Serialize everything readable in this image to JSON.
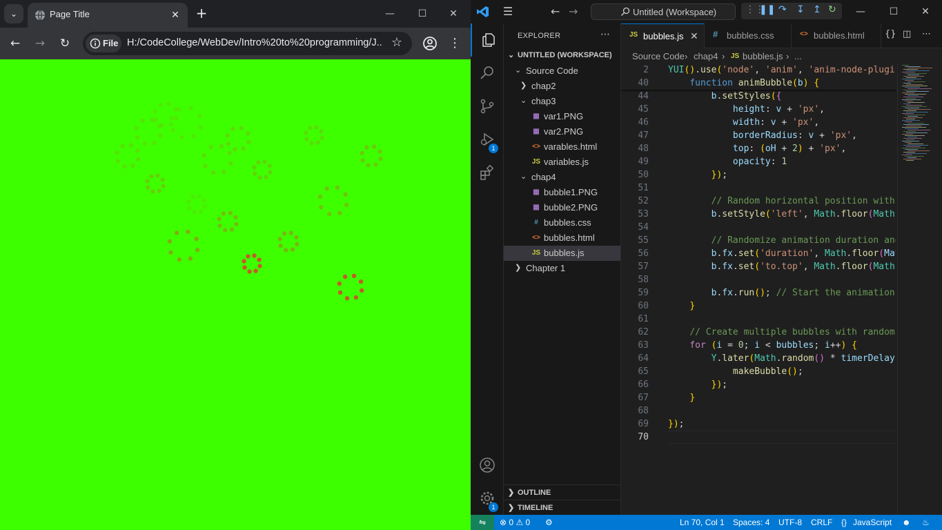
{
  "browser": {
    "tab_title": "Page Title",
    "address_chip": "File",
    "url": "H:/CodeCollege/WebDev/Intro%20to%20programming/J...",
    "page_background": "#3eff00"
  },
  "vscode": {
    "search_text": "Untitled (Workspace)",
    "explorer": {
      "header": "EXPLORER",
      "workspace": "UNTITLED (WORKSPACE)",
      "items": [
        {
          "label": "Source Code",
          "kind": "folder-open"
        },
        {
          "label": "chap2",
          "kind": "folder-closed"
        },
        {
          "label": "chap3",
          "kind": "folder-open"
        },
        {
          "label": "var1.PNG",
          "kind": "image"
        },
        {
          "label": "var2.PNG",
          "kind": "image"
        },
        {
          "label": "varables.html",
          "kind": "html"
        },
        {
          "label": "variables.js",
          "kind": "js"
        },
        {
          "label": "chap4",
          "kind": "folder-open"
        },
        {
          "label": "bubble1.PNG",
          "kind": "image"
        },
        {
          "label": "bubble2.PNG",
          "kind": "image"
        },
        {
          "label": "bubbles.css",
          "kind": "css"
        },
        {
          "label": "bubbles.html",
          "kind": "html"
        },
        {
          "label": "bubbles.js",
          "kind": "js"
        },
        {
          "label": "Chapter 1",
          "kind": "folder-closed"
        }
      ],
      "outline": "OUTLINE",
      "timeline": "TIMELINE"
    },
    "tabs": [
      {
        "icon": "JS",
        "label": "bubbles.js"
      },
      {
        "icon": "#",
        "label": "bubbles.css"
      },
      {
        "icon": "<>",
        "label": "bubbles.html"
      }
    ],
    "breadcrumb": [
      "Source Code",
      "chap4",
      "bubbles.js",
      "..."
    ],
    "breadcrumb_js_icon": "JS",
    "code_lines": [
      {
        "n": "2",
        "text": "YUI().use('node', 'anim', 'anim-node-plugin"
      },
      {
        "n": "40",
        "text": "    function animBubble(b) {"
      },
      {
        "n": "44",
        "text": "        b.setStyles({"
      },
      {
        "n": "45",
        "text": "            height: v + 'px',"
      },
      {
        "n": "46",
        "text": "            width: v + 'px',"
      },
      {
        "n": "47",
        "text": "            borderRadius: v + 'px',"
      },
      {
        "n": "48",
        "text": "            top: (oH + 2) + 'px',"
      },
      {
        "n": "49",
        "text": "            opacity: 1"
      },
      {
        "n": "50",
        "text": "        });"
      },
      {
        "n": "51",
        "text": ""
      },
      {
        "n": "52",
        "text": "        // Random horizontal position withi"
      },
      {
        "n": "53",
        "text": "        b.setStyle('left', Math.floor(Math."
      },
      {
        "n": "54",
        "text": ""
      },
      {
        "n": "55",
        "text": "        // Randomize animation duration and"
      },
      {
        "n": "56",
        "text": "        b.fx.set('duration', Math.floor(Mat"
      },
      {
        "n": "57",
        "text": "        b.fx.set('to.top', Math.floor(Math."
      },
      {
        "n": "58",
        "text": ""
      },
      {
        "n": "59",
        "text": "        b.fx.run(); // Start the animation"
      },
      {
        "n": "60",
        "text": "    }"
      },
      {
        "n": "61",
        "text": ""
      },
      {
        "n": "62",
        "text": "    // Create multiple bubbles with random"
      },
      {
        "n": "63",
        "text": "    for (i = 0; i < bubbles; i++) {"
      },
      {
        "n": "64",
        "text": "        Y.later(Math.random() * timerDelay,"
      },
      {
        "n": "65",
        "text": "            makeBubble();"
      },
      {
        "n": "66",
        "text": "        });"
      },
      {
        "n": "67",
        "text": "    }"
      },
      {
        "n": "68",
        "text": ""
      },
      {
        "n": "69",
        "text": "});"
      },
      {
        "n": "70",
        "text": ""
      }
    ],
    "status": {
      "errors": "0",
      "warnings": "0",
      "position": "Ln 70, Col 1",
      "spaces": "Spaces: 4",
      "encoding": "UTF-8",
      "eol": "CRLF",
      "braces": "{}",
      "language": "JavaScript"
    },
    "badges": {
      "run_debug": "1",
      "manage": "1"
    },
    "accent": "#0078d4"
  }
}
